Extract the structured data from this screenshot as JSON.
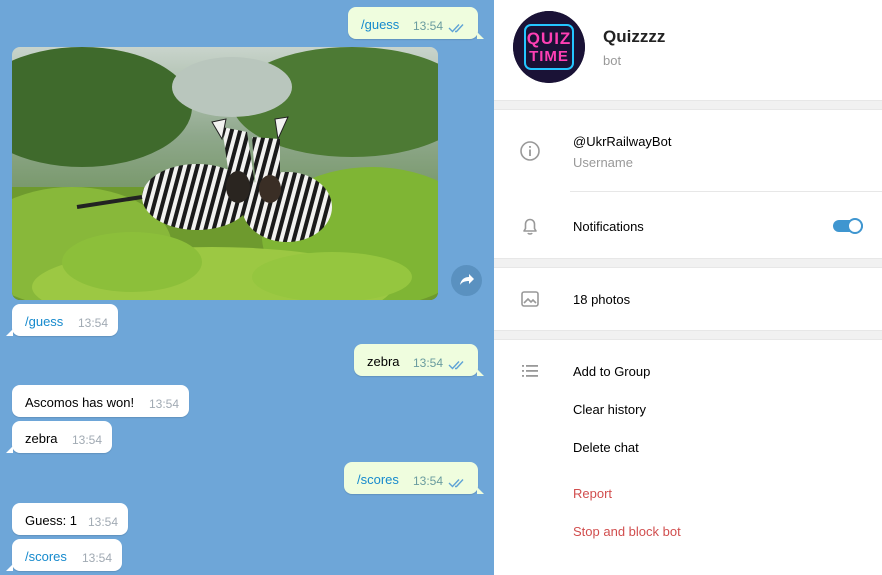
{
  "chat": {
    "messages": [
      {
        "text": "/guess",
        "time": "13:54"
      },
      {
        "text": "/guess",
        "time": "13:54"
      },
      {
        "text": "zebra",
        "time": "13:54"
      },
      {
        "text": "Ascomos has won!",
        "time": "13:54"
      },
      {
        "text": "zebra",
        "time": "13:54"
      },
      {
        "text": "/scores",
        "time": "13:54"
      },
      {
        "text": "Guess: 1",
        "time": "13:54"
      },
      {
        "text": "/scores",
        "time": "13:54"
      }
    ]
  },
  "profile": {
    "name": "Quizzzz",
    "status": "bot",
    "avatar_text_line1": "QUIZ",
    "avatar_text_line2": "TIME",
    "username": "@UkrRailwayBot",
    "username_label": "Username",
    "notifications_label": "Notifications",
    "notifications_on": true,
    "photos_label": "18 photos",
    "actions": [
      "Add to Group",
      "Clear history",
      "Delete chat"
    ],
    "danger_actions": [
      "Report",
      "Stop and block bot"
    ]
  },
  "colors": {
    "chat_bg": "#6ea6d8",
    "outgoing_bubble": "#effdde",
    "link": "#168acd",
    "toggle": "#3f96d0",
    "danger": "#d14e4e"
  },
  "icons": [
    "double-check-icon",
    "forward-icon",
    "info-icon",
    "bell-icon",
    "photo-icon",
    "list-icon"
  ]
}
